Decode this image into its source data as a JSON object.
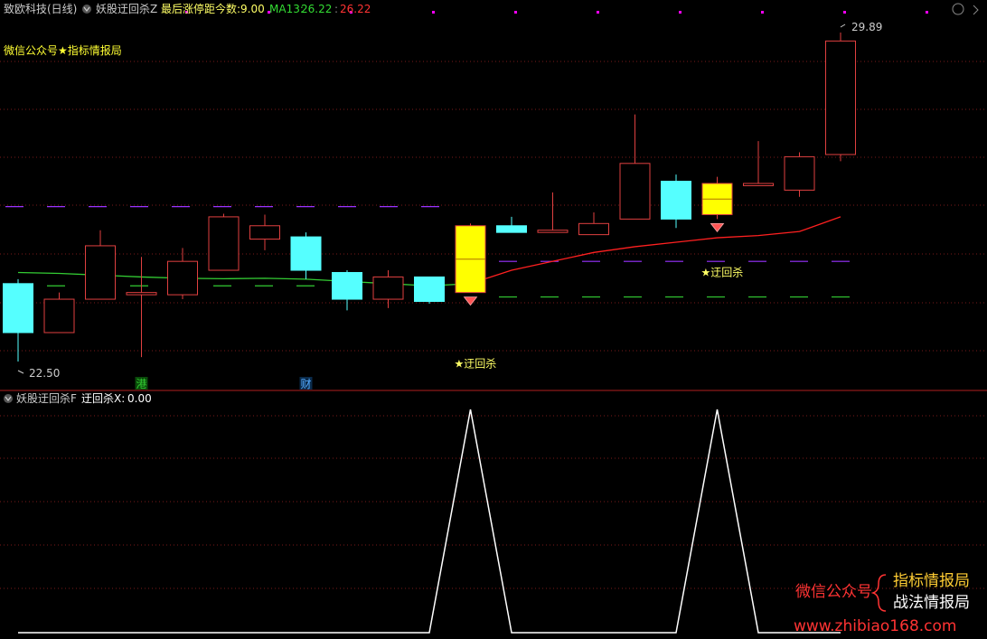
{
  "header": {
    "stock_name": "致欧科技(日线)",
    "indicator_name": "妖股迂回杀Z",
    "days_label": "最后涨停距今数:",
    "days_value": "9.00",
    "ma_label": "MA13:",
    "ma_value": "26.22",
    "extra_value": "26.22"
  },
  "watermark_top": "微信公众号★指标情报局",
  "lower_header": {
    "indicator_name": "妖股迂回杀F",
    "value_label": "迂回杀X:",
    "value": "0.00"
  },
  "brand": {
    "left": "微信公众号",
    "right_top": "指标情报局",
    "right_bottom": "战法情报局",
    "url": "www.zhibiao168.com"
  },
  "colors": {
    "up": "#e04040",
    "down": "#55ffff",
    "signal": "#ffff00",
    "ma": "#33cc33",
    "trend": "#ff2020",
    "purple_level": "#9933ff",
    "green_level": "#33cc33",
    "grid": "#7a1a1a",
    "white": "#ffffff",
    "magenta": "#ff00ff"
  },
  "chart_data": [
    {
      "type": "candlestick",
      "price_high_label": "29.89",
      "price_low_label": "22.50",
      "candles": [
        {
          "o": 24.25,
          "c": 23.15,
          "h": 24.35,
          "l": 22.5,
          "color": "down"
        },
        {
          "o": 23.15,
          "c": 23.9,
          "h": 24.05,
          "l": 23.15,
          "color": "up"
        },
        {
          "o": 23.9,
          "c": 25.1,
          "h": 25.45,
          "l": 23.9,
          "color": "up"
        },
        {
          "o": 24.0,
          "c": 24.05,
          "h": 24.85,
          "l": 22.6,
          "color": "up"
        },
        {
          "o": 24.0,
          "c": 24.75,
          "h": 25.05,
          "l": 23.9,
          "color": "up"
        },
        {
          "o": 24.55,
          "c": 25.75,
          "h": 25.82,
          "l": 24.55,
          "color": "up"
        },
        {
          "o": 25.25,
          "c": 25.55,
          "h": 25.8,
          "l": 25.0,
          "color": "up"
        },
        {
          "o": 25.3,
          "c": 24.55,
          "h": 25.4,
          "l": 24.35,
          "color": "down"
        },
        {
          "o": 24.5,
          "c": 23.9,
          "h": 24.55,
          "l": 23.65,
          "color": "down"
        },
        {
          "o": 24.4,
          "c": 23.9,
          "h": 24.55,
          "l": 23.7,
          "color": "up"
        },
        {
          "o": 24.4,
          "c": 23.85,
          "h": 24.4,
          "l": 23.8,
          "color": "down"
        },
        {
          "o": 24.05,
          "c": 25.55,
          "h": 25.6,
          "l": 24.05,
          "color": "signal",
          "gem": "below"
        },
        {
          "o": 25.55,
          "c": 25.4,
          "h": 25.75,
          "l": 25.4,
          "color": "down"
        },
        {
          "o": 25.4,
          "c": 25.45,
          "h": 26.3,
          "l": 25.4,
          "color": "up"
        },
        {
          "o": 25.35,
          "c": 25.6,
          "h": 25.85,
          "l": 25.35,
          "color": "up"
        },
        {
          "o": 25.7,
          "c": 26.95,
          "h": 28.05,
          "l": 25.7,
          "color": "up"
        },
        {
          "o": 26.55,
          "c": 25.7,
          "h": 26.7,
          "l": 25.5,
          "color": "down"
        },
        {
          "o": 25.8,
          "c": 26.5,
          "h": 26.65,
          "l": 25.7,
          "color": "signal",
          "gem": "below"
        },
        {
          "o": 26.45,
          "c": 26.5,
          "h": 27.45,
          "l": 26.45,
          "color": "up"
        },
        {
          "o": 26.35,
          "c": 27.1,
          "h": 27.2,
          "l": 26.2,
          "color": "up"
        },
        {
          "o": 27.15,
          "c": 29.7,
          "h": 29.89,
          "l": 27.0,
          "color": "up"
        }
      ],
      "ma_line": [
        24.5,
        24.48,
        24.44,
        24.4,
        24.37,
        24.36,
        24.37,
        24.35,
        24.3,
        24.25,
        24.2,
        24.25,
        24.55,
        24.75,
        24.95,
        25.08,
        25.18,
        25.28,
        25.33,
        25.42,
        25.75
      ],
      "ma_start_index": 0,
      "levels": [
        {
          "value": 25.98,
          "color": "purple_level",
          "from": 0,
          "to": 10
        },
        {
          "value": 24.2,
          "color": "green_level",
          "from": 0,
          "to": 10
        },
        {
          "value": 24.75,
          "color": "purple_level",
          "from": 12,
          "to": 20
        },
        {
          "value": 23.95,
          "color": "green_level",
          "from": 12,
          "to": 20
        }
      ],
      "markers": [
        {
          "index": 3,
          "text": "港",
          "color": "#33cc33"
        },
        {
          "index": 7,
          "text": "财",
          "color": "#55aaff"
        }
      ],
      "signal_labels": [
        {
          "index": 11,
          "text": "★迂回杀",
          "value": 22.45
        },
        {
          "index": 17,
          "text": "★迂回杀",
          "value": 24.5
        }
      ]
    },
    {
      "type": "line",
      "name": "迂回杀X",
      "values": [
        0,
        0,
        0,
        0,
        0,
        0,
        0,
        0,
        0,
        0,
        0,
        1,
        0,
        0,
        0,
        0,
        0,
        1,
        0,
        0,
        0
      ],
      "ylim": [
        0,
        1
      ]
    }
  ]
}
